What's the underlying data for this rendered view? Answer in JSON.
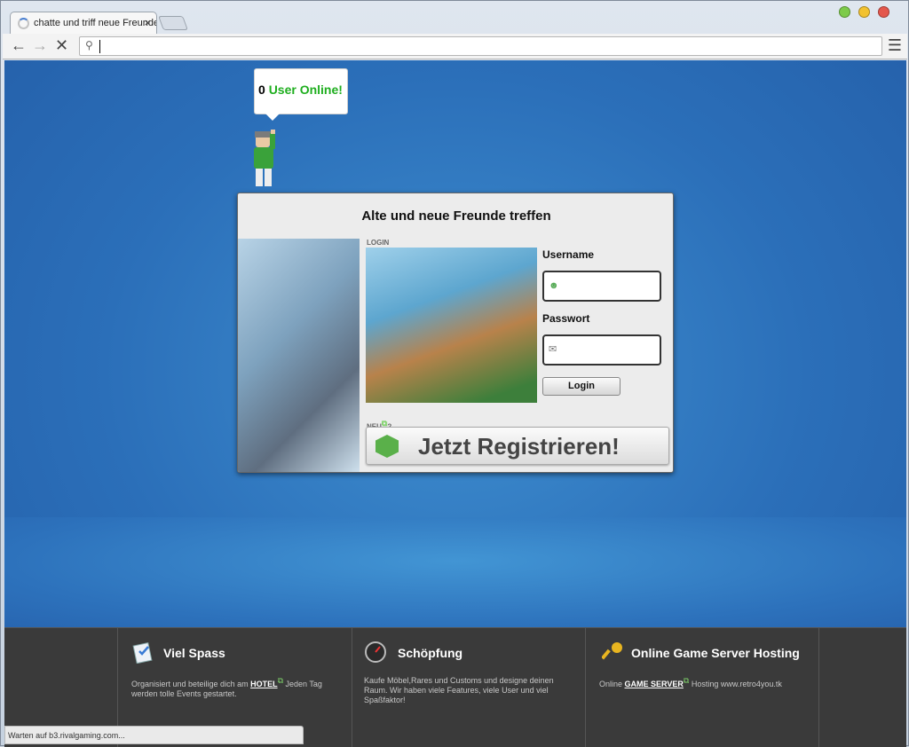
{
  "browser": {
    "tab_title": "chatte und triff neue Freunde",
    "tab_close": "×",
    "url": "",
    "status_text": "Warten auf b3.rivalgaming.com..."
  },
  "online": {
    "count": "0",
    "label": "User Online!"
  },
  "login_card": {
    "title": "Alte und neue Freunde treffen",
    "section_label": "LOGIN",
    "username_label": "Username",
    "password_label": "Passwort",
    "login_button": "Login",
    "new_label": "NEU",
    "new_question": "?",
    "register_button": "Jetzt Registrieren!"
  },
  "footer": {
    "columns": [
      {
        "title": "Viel Spass",
        "text_pre": "Organisiert und beteilige dich am ",
        "link": "HOTEL",
        "text_post": " Jeden Tag werden tolle Events gestartet.",
        "icon": "checklist-icon"
      },
      {
        "title": "Schöpfung",
        "text_pre": "Kaufe Möbel,Rares und Customs und designe deinen Raum. Wir haben viele Features, viele User und viel Spaßfaktor!",
        "icon": "gauge-icon"
      },
      {
        "title": "Online Game Server Hosting",
        "text_pre": "Online ",
        "link": "GAME SERVER",
        "text_post": " Hosting www.retro4you.tk",
        "icon": "key-icon"
      }
    ]
  },
  "colors": {
    "page_blue": "#2b6fb9",
    "online_green": "#1fae1f",
    "footer_bg": "#3a3a3a"
  }
}
